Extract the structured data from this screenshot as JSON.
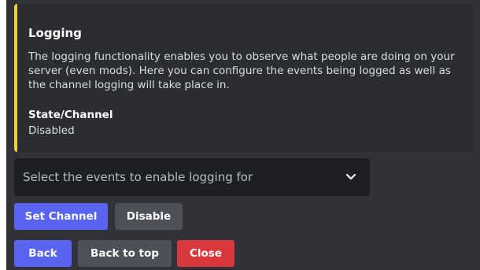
{
  "embed": {
    "accent_color": "#f0d33c",
    "title": "Logging",
    "description": "The logging functionality enables you to observe what people are doing on your server (even mods). Here you can configure the events being logged as well as the channel logging will take place in.",
    "field": {
      "name": "State/Channel",
      "value": "Disabled"
    }
  },
  "select": {
    "placeholder": "Select the events to enable logging for",
    "icon": "chevron-down-icon"
  },
  "buttons": {
    "set_channel": "Set Channel",
    "disable": "Disable",
    "back": "Back",
    "back_to_top": "Back to top",
    "close": "Close"
  },
  "colors": {
    "primary": "#5865f2",
    "secondary": "#4e5058",
    "danger": "#da373c",
    "background": "#313338",
    "embed_background": "#2b2d31"
  }
}
